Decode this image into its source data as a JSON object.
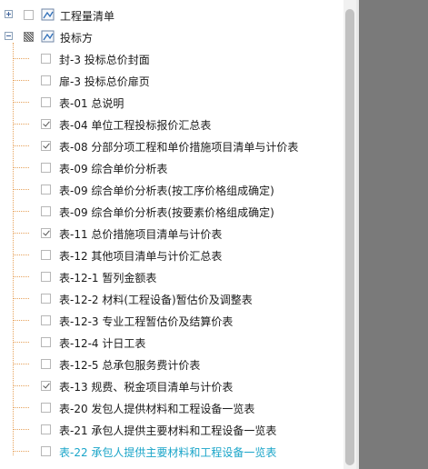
{
  "tree": {
    "root_collapsed": {
      "label": "工程量清单",
      "expanded": false,
      "checked": false
    },
    "root_expanded": {
      "label": "投标方",
      "expanded": true,
      "state": "partial"
    },
    "items": [
      {
        "label": "封-3 投标总价封面",
        "checked": false
      },
      {
        "label": "扉-3 投标总价扉页",
        "checked": false
      },
      {
        "label": "表-01 总说明",
        "checked": false
      },
      {
        "label": "表-04 单位工程投标报价汇总表",
        "checked": true
      },
      {
        "label": "表-08 分部分项工程和单价措施项目清单与计价表",
        "checked": true
      },
      {
        "label": "表-09 综合单价分析表",
        "checked": false
      },
      {
        "label": "表-09 综合单价分析表(按工序价格组成确定)",
        "checked": false
      },
      {
        "label": "表-09 综合单价分析表(按要素价格组成确定)",
        "checked": false
      },
      {
        "label": "表-11 总价措施项目清单与计价表",
        "checked": true
      },
      {
        "label": "表-12 其他项目清单与计价汇总表",
        "checked": false
      },
      {
        "label": "表-12-1 暂列金额表",
        "checked": false
      },
      {
        "label": "表-12-2 材料(工程设备)暂估价及调整表",
        "checked": false
      },
      {
        "label": "表-12-3 专业工程暂估价及结算价表",
        "checked": false
      },
      {
        "label": "表-12-4 计日工表",
        "checked": false
      },
      {
        "label": "表-12-5 总承包服务费计价表",
        "checked": false
      },
      {
        "label": "表-13 规费、税金项目清单与计价表",
        "checked": true
      },
      {
        "label": "表-20 发包人提供材料和工程设备一览表",
        "checked": false
      },
      {
        "label": "表-21 承包人提供主要材料和工程设备一览表",
        "checked": false
      },
      {
        "label": "表-22 承包人提供主要材料和工程设备一览表",
        "checked": false,
        "active": true
      }
    ]
  },
  "colors": {
    "active_text": "#1aa5c9",
    "tree_line": "#e6a25c",
    "right_panel": "#7a7a7a"
  }
}
